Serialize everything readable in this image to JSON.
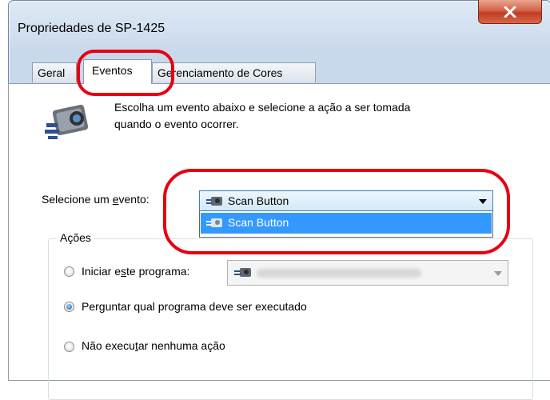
{
  "window": {
    "title": "Propriedades de SP-1425",
    "close_label": "X"
  },
  "tabs": [
    {
      "label": "Geral",
      "active": false
    },
    {
      "label": "Eventos",
      "active": true
    },
    {
      "label": "Gerenciamento de Cores",
      "active": false
    }
  ],
  "info": {
    "icon": "scanner-camera-icon",
    "line1": "Escolha um evento abaixo e selecione a ação a ser tomada",
    "line2": "quando o evento ocorrer."
  },
  "event": {
    "label_before": "Selecione um ",
    "label_accel": "e",
    "label_after": "vento:",
    "selected": "Scan Button",
    "options": [
      "Scan Button"
    ]
  },
  "actions": {
    "group_label": "Ações",
    "start_program": {
      "before": "Iniciar e",
      "accel": "s",
      "after": "te programa:",
      "checked": false
    },
    "ask_program": {
      "before": "Per",
      "accel": "g",
      "after": "untar qual programa deve ser executado",
      "checked": true
    },
    "no_action": {
      "before": "Não execu",
      "accel": "t",
      "after": "ar nenhuma ação",
      "checked": false
    }
  },
  "colors": {
    "highlight": "#e60012",
    "selection": "#3399ff"
  }
}
